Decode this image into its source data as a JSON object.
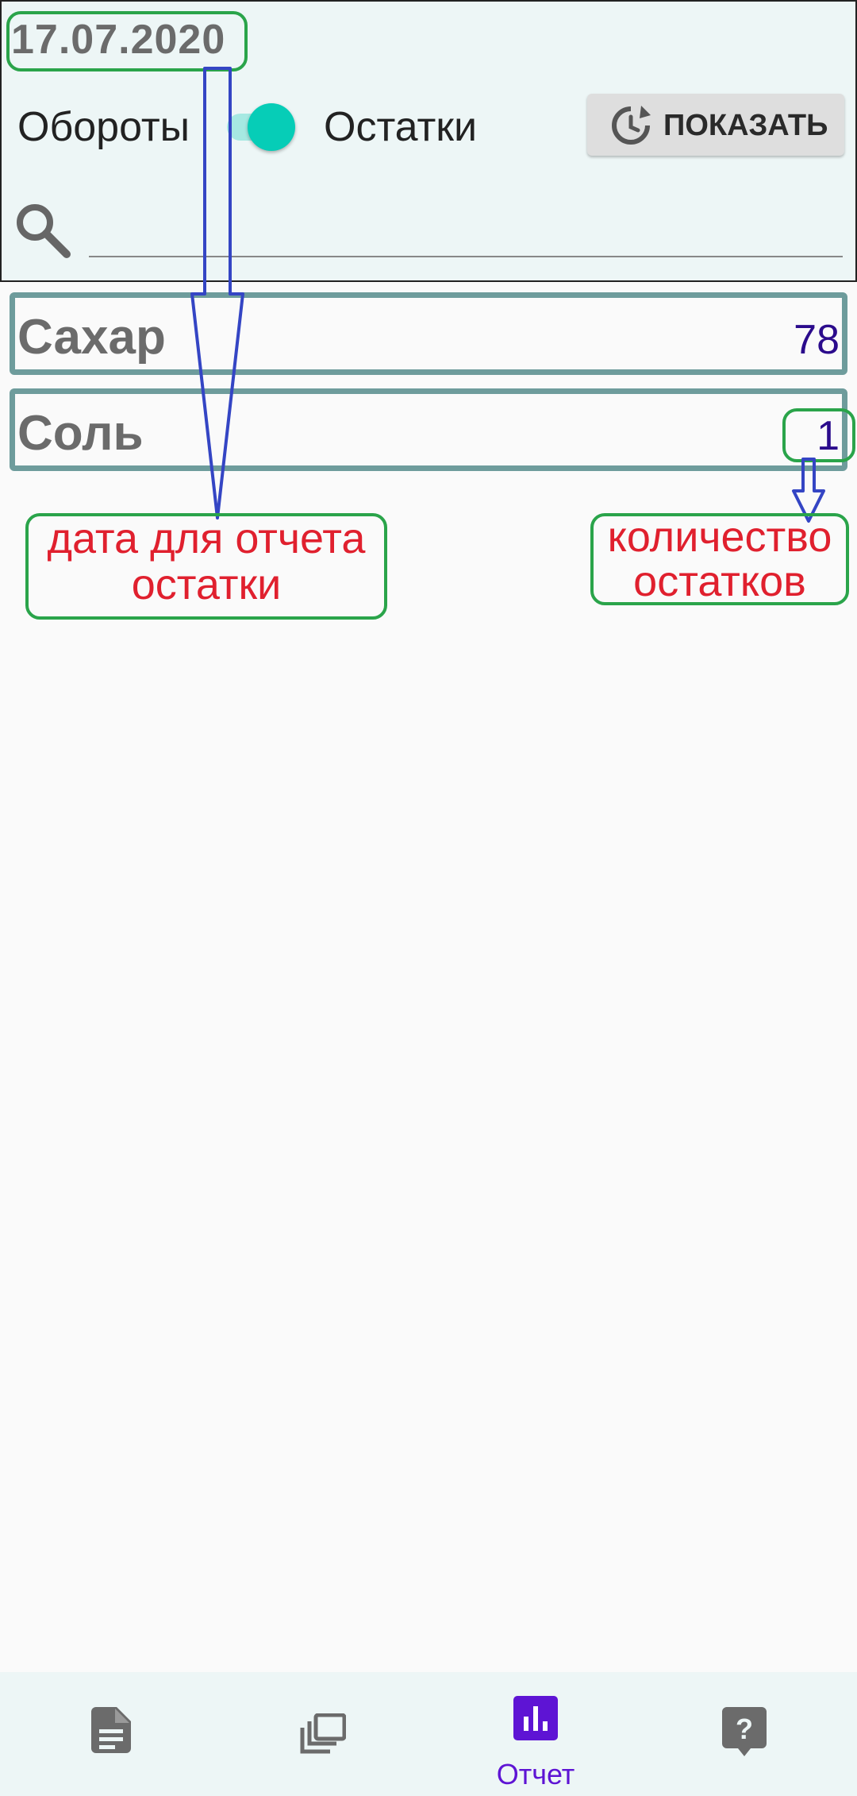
{
  "header": {
    "date": "17.07.2020"
  },
  "mode": {
    "left_label": "Обороты",
    "right_label": "Остатки",
    "switch_on": true,
    "show_button_label": "ПОКАЗАТЬ"
  },
  "search": {
    "placeholder": "",
    "value": ""
  },
  "items": [
    {
      "name": "Сахар",
      "qty": "78"
    },
    {
      "name": "Соль",
      "qty": "1"
    }
  ],
  "annotations": {
    "date_note_line1": "дата для отчета",
    "date_note_line2": "остатки",
    "qty_note_line1": "количество",
    "qty_note_line2": "остатков"
  },
  "nav": {
    "items": [
      {
        "icon": "document-icon",
        "label": ""
      },
      {
        "icon": "copy-icon",
        "label": ""
      },
      {
        "icon": "bar-chart-icon",
        "label": "Отчет"
      },
      {
        "icon": "help-icon",
        "label": ""
      }
    ],
    "active_color": "#5e14d4",
    "inactive_color": "#6b6b6b"
  },
  "colors": {
    "teal_accent": "#06cdb7",
    "border_teal": "#6e9c9c",
    "annotation_red": "#e0202e",
    "annotation_green": "#2aa44a",
    "arrow_blue": "#3445c4"
  }
}
